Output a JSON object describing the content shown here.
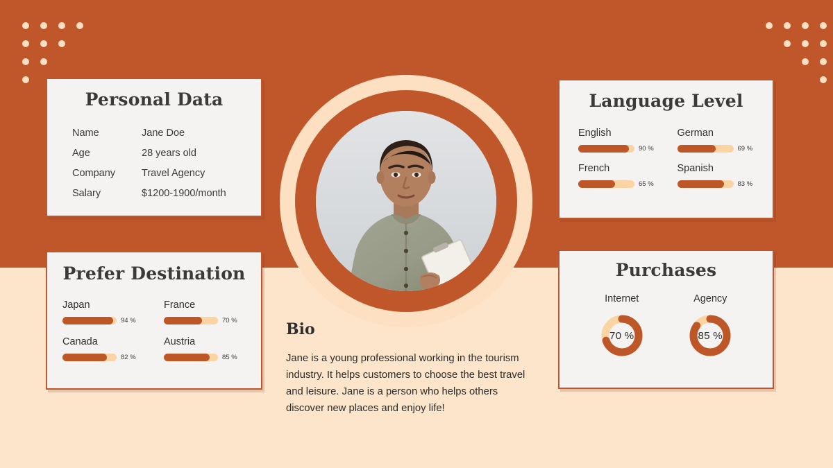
{
  "theme": {
    "orange": "#C0572B",
    "cream": "#FDE5CB",
    "peach": "#FBD4A3",
    "card_bg": "#F4F3F1",
    "text_dark": "#2F2F2E"
  },
  "personal_data": {
    "title": "Personal Data",
    "rows": [
      {
        "label": "Name",
        "value": "Jane Doe"
      },
      {
        "label": "Age",
        "value": "28 years old"
      },
      {
        "label": "Company",
        "value": "Travel Agency"
      },
      {
        "label": "Salary",
        "value": "$1200-1900/month"
      }
    ]
  },
  "language_level": {
    "title": "Language Level",
    "items": [
      {
        "label": "English",
        "percent": 90,
        "percent_text": "90 %"
      },
      {
        "label": "German",
        "percent": 69,
        "percent_text": "69 %"
      },
      {
        "label": "French",
        "percent": 65,
        "percent_text": "65 %"
      },
      {
        "label": "Spanish",
        "percent": 83,
        "percent_text": "83 %"
      }
    ]
  },
  "prefer_destination": {
    "title": "Prefer Destination",
    "items": [
      {
        "label": "Japan",
        "percent": 94,
        "percent_text": "94 %"
      },
      {
        "label": "France",
        "percent": 70,
        "percent_text": "70 %"
      },
      {
        "label": "Canada",
        "percent": 82,
        "percent_text": "82 %"
      },
      {
        "label": "Austria",
        "percent": 85,
        "percent_text": "85 %"
      }
    ]
  },
  "purchases": {
    "title": "Purchases",
    "items": [
      {
        "label": "Internet",
        "percent": 70,
        "percent_text": "70 %"
      },
      {
        "label": "Agency",
        "percent": 85,
        "percent_text": "85 %"
      }
    ]
  },
  "bio": {
    "title": "Bio",
    "text": "Jane is a young professional working in the tourism industry. It helps customers to choose the best travel and leisure. Jane is a person who helps others discover new places and enjoy life!"
  },
  "portrait": {
    "alt": "woman-holding-clipboard-photo"
  },
  "chart_data": [
    {
      "type": "bar",
      "title": "Language Level",
      "categories": [
        "English",
        "German",
        "French",
        "Spanish"
      ],
      "values": [
        90,
        69,
        65,
        83
      ],
      "xlabel": "",
      "ylabel": "",
      "ylim": [
        0,
        100
      ],
      "orientation": "horizontal",
      "grid": false,
      "legend": "none"
    },
    {
      "type": "bar",
      "title": "Prefer Destination",
      "categories": [
        "Japan",
        "France",
        "Canada",
        "Austria"
      ],
      "values": [
        94,
        70,
        82,
        85
      ],
      "xlabel": "",
      "ylabel": "",
      "ylim": [
        0,
        100
      ],
      "orientation": "horizontal",
      "grid": false,
      "legend": "none"
    },
    {
      "type": "pie",
      "title": "Purchases",
      "categories": [
        "Internet",
        "Agency"
      ],
      "values": [
        70,
        85
      ],
      "subtype": "donut",
      "ylim": [
        0,
        100
      ],
      "legend": "none"
    }
  ]
}
